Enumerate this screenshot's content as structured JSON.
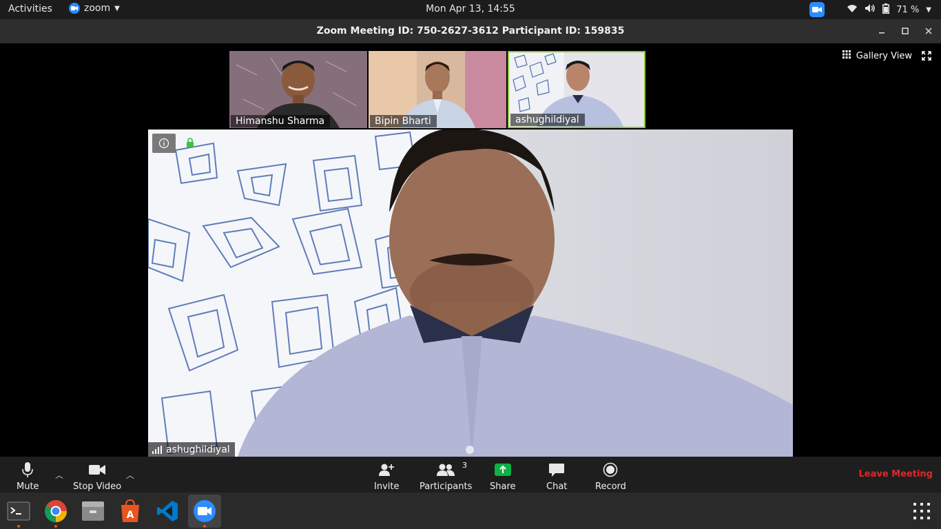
{
  "topbar": {
    "activities": "Activities",
    "app_name": "zoom",
    "clock": "Mon Apr 13, 14:55",
    "battery": "71 %"
  },
  "window": {
    "title": "Zoom Meeting ID: 750-2627-3612 Participant ID: 159835"
  },
  "meeting": {
    "gallery_view_label": "Gallery View",
    "thumbnails": [
      {
        "name": "Himanshu Sharma",
        "active": false
      },
      {
        "name": "Bipin Bharti",
        "active": false
      },
      {
        "name": "ashughildiyal",
        "active": true
      }
    ],
    "active_speaker": "ashughildiyal"
  },
  "toolbar": {
    "mute": "Mute",
    "stop_video": "Stop Video",
    "invite": "Invite",
    "participants": "Participants",
    "participants_count": "3",
    "share": "Share",
    "chat": "Chat",
    "record": "Record",
    "leave": "Leave Meeting"
  },
  "dock": {
    "apps": [
      "terminal-icon",
      "chrome-icon",
      "files-icon",
      "software-icon",
      "vscode-icon",
      "zoom-icon",
      "show-apps-icon"
    ]
  },
  "colors": {
    "zoom_blue": "#2d8cff",
    "active_border": "#8cc63f",
    "share_green": "#0cb246",
    "leave_red": "#e02828"
  }
}
